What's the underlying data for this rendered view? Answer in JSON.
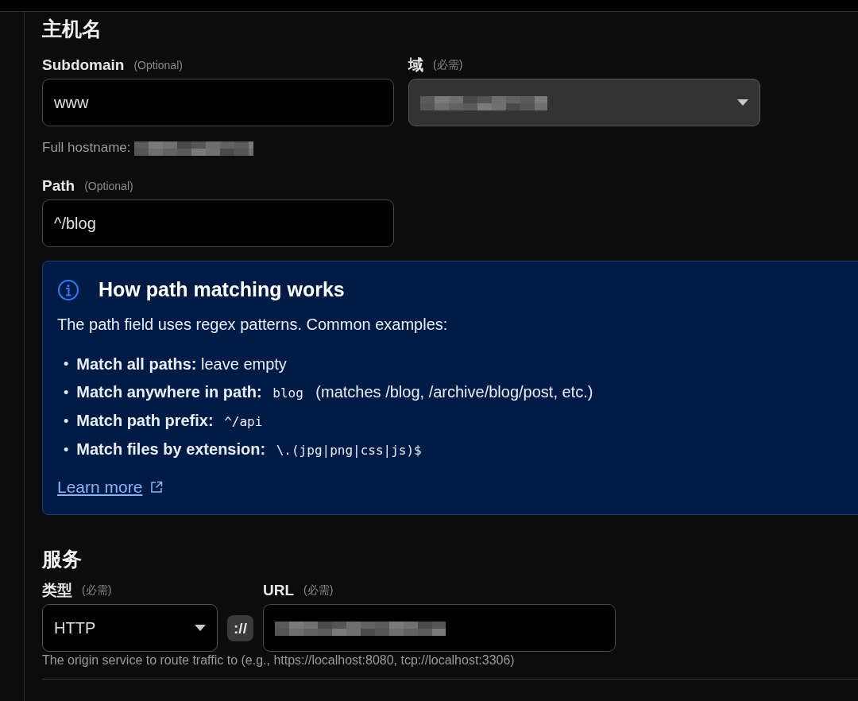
{
  "hostname": {
    "heading": "主机名",
    "subdomain": {
      "label": "Subdomain",
      "note": "(Optional)",
      "value": "www"
    },
    "domain": {
      "label": "域",
      "note": "(必需)"
    },
    "full_hostname": {
      "label": "Full hostname:"
    },
    "path": {
      "label": "Path",
      "note": "(Optional)",
      "value": "^/blog"
    }
  },
  "info": {
    "title": "How path matching works",
    "intro": "The path field uses regex patterns. Common examples:",
    "examples": [
      {
        "bullet": "•",
        "label": "Match all paths:",
        "text": "leave empty"
      },
      {
        "bullet": "•",
        "label": "Match anywhere in path:",
        "code": "blog",
        "text": "(matches /blog, /archive/blog/post, etc.)"
      },
      {
        "bullet": "•",
        "label": "Match path prefix:",
        "code": "^/api"
      },
      {
        "bullet": "•",
        "label": "Match files by extension:",
        "code": "\\.(jpg|png|css|js)$"
      }
    ],
    "link": "Learn more"
  },
  "service": {
    "heading": "服务",
    "type": {
      "label": "类型",
      "note": "(必需)",
      "value": "HTTP"
    },
    "separator": "://",
    "url": {
      "label": "URL",
      "note": "(必需)"
    },
    "help": "The origin service to route traffic to (e.g., https://localhost:8080, tcp://localhost:3306)"
  }
}
